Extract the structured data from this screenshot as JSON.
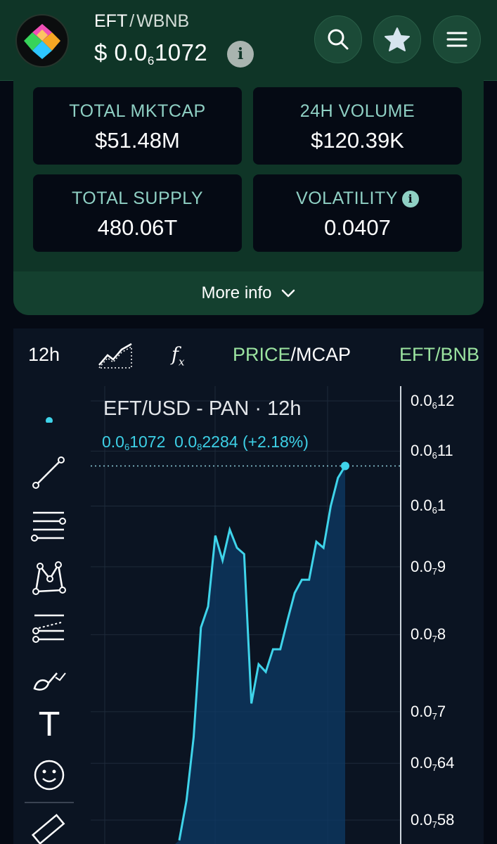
{
  "header": {
    "base_token": "EFT",
    "separator": "/",
    "quote_token": "WBNB",
    "price_prefix": "$ 0.0",
    "price_subscript": "6",
    "price_suffix": "1072",
    "info_glyph": "i",
    "buttons": [
      "search-icon",
      "star-icon",
      "menu-icon"
    ]
  },
  "stats": {
    "total_mktcap_label": "TOTAL MKTCAP",
    "total_mktcap_value": "$51.48M",
    "volume_label": "24H VOLUME",
    "volume_value": "$120.39K",
    "supply_label": "TOTAL SUPPLY",
    "supply_value": "480.06T",
    "volatility_label": "VOLATILITY",
    "volatility_value": "0.0407"
  },
  "more_info_label": "More info",
  "toolbar": {
    "interval": "12h",
    "fx_label": "f",
    "price_label": "PRICE",
    "slash": "/",
    "mcap_label": "MCAP",
    "pair_label": "EFT/BNB"
  },
  "chart": {
    "title": "EFT/USD - PAN · 12h",
    "current_prefix": "0.0",
    "current_sub": "6",
    "current_suffix": "1072",
    "change_prefix": "0.0",
    "change_sub": "8",
    "change_suffix": "2284 (+2.18%)",
    "text_tool_glyph": "T",
    "y_ticks": [
      {
        "prefix": "0.0",
        "sub": "6",
        "suffix": "12"
      },
      {
        "prefix": "0.0",
        "sub": "6",
        "suffix": "11"
      },
      {
        "prefix": "0.0",
        "sub": "6",
        "suffix": "1"
      },
      {
        "prefix": "0.0",
        "sub": "7",
        "suffix": "9"
      },
      {
        "prefix": "0.0",
        "sub": "7",
        "suffix": "8"
      },
      {
        "prefix": "0.0",
        "sub": "7",
        "suffix": "7"
      },
      {
        "prefix": "0.0",
        "sub": "7",
        "suffix": "64"
      },
      {
        "prefix": "0.0",
        "sub": "7",
        "suffix": "58"
      }
    ],
    "line_color": "#3fd4ea",
    "area_color": "#0e3a66"
  },
  "chart_data": {
    "type": "area",
    "title": "EFT/USD - PAN · 12h",
    "y_scale": "log",
    "y_ticks": [
      1.2e-07,
      1.1e-07,
      1e-07,
      9e-08,
      8e-08,
      7e-08,
      6.4e-08,
      5.8e-08
    ],
    "series": [
      {
        "name": "EFT/USD",
        "x": [
          0,
          1,
          2,
          3,
          4,
          5,
          6,
          7,
          8,
          9,
          10,
          11,
          12,
          13,
          14,
          15,
          16,
          17,
          18,
          19,
          20,
          21,
          22,
          23,
          24,
          25,
          26,
          27,
          28
        ],
        "values": [
          5.6e-08,
          6e-08,
          6.7e-08,
          8.1e-08,
          8.4e-08,
          9.5e-08,
          9.1e-08,
          9.6e-08,
          9.3e-08,
          9.2e-08,
          7.1e-08,
          7.6e-08,
          7.5e-08,
          7.8e-08,
          7.8e-08,
          8.2e-08,
          8.6e-08,
          8.8e-08,
          8.8e-08,
          9.4e-08,
          9.3e-08,
          1e-07,
          1.05e-07,
          1.072e-07,
          1.072e-07,
          1.072e-07,
          1.072e-07,
          1.072e-07,
          1.072e-07
        ]
      }
    ],
    "last_value": 1.072e-07,
    "grid": true,
    "legend": "none"
  }
}
